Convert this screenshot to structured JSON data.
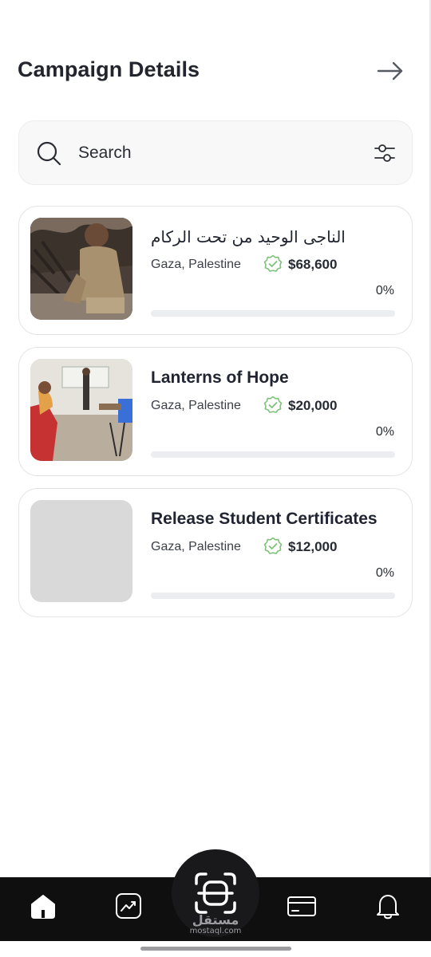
{
  "header": {
    "title": "Campaign Details",
    "arrow_icon": "arrow-right-icon"
  },
  "search": {
    "placeholder": "Search",
    "icons": [
      "search-icon",
      "filter-sliders-icon"
    ]
  },
  "campaigns": [
    {
      "title": "الناجى الوحيد من تحت الركام",
      "location": "Gaza, Palestine",
      "amount": "$68,600",
      "percent_label": "0%",
      "progress": 0,
      "thumbnail": "photo-boy-rubble"
    },
    {
      "title": "Lanterns of Hope",
      "location": "Gaza, Palestine",
      "amount": "$20,000",
      "percent_label": "0%",
      "progress": 0,
      "thumbnail": "photo-classroom"
    },
    {
      "title": "Release Student Certificates",
      "location": "Gaza, Palestine",
      "amount": "$12,000",
      "percent_label": "0%",
      "progress": 0,
      "thumbnail": "placeholder-gray"
    }
  ],
  "bottom_nav": {
    "items": [
      "home-icon",
      "chart-trend-icon",
      "scan-icon",
      "card-icon",
      "bell-icon"
    ],
    "active": "home-icon"
  },
  "watermark": {
    "arabic": "مستقل",
    "latin": "mostaql.com"
  },
  "colors": {
    "verified": "#7ec27a",
    "nav_bg": "#0f0f10",
    "progress_track": "#ebedf1"
  }
}
